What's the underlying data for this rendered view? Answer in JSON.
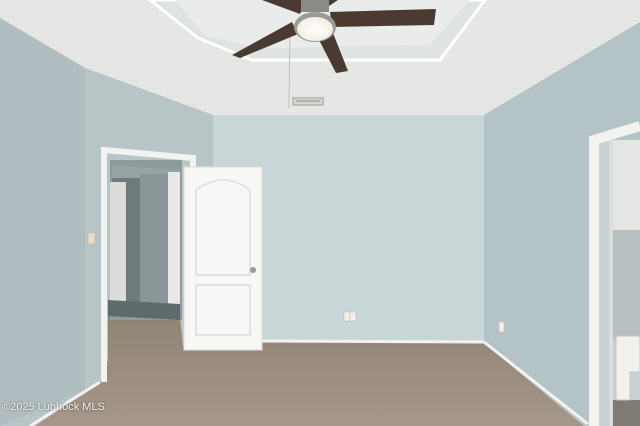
{
  "photo": {
    "watermark": "©2025 Lubbock MLS",
    "colors": {
      "ceiling": "#e6e6e4",
      "back_wall": "#c8d6d8",
      "left_wall": "#b7c5c7",
      "right_wall": "#b4c3c5",
      "carpet": "#9a8c7b",
      "trim": "#f2f2f0",
      "fan_blade": "#4a3a30"
    }
  }
}
